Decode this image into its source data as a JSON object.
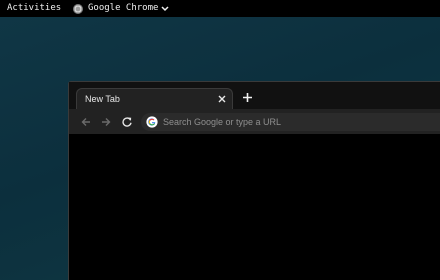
{
  "topbar": {
    "activities_label": "Activities",
    "app_name": "Google Chrome",
    "app_icon": "chrome-icon"
  },
  "browser": {
    "tabs": [
      {
        "label": "New Tab",
        "active": true
      }
    ],
    "toolbar": {
      "back_icon": "arrow-left-icon",
      "forward_icon": "arrow-right-icon",
      "reload_icon": "reload-icon"
    },
    "omnibox": {
      "value": "",
      "placeholder": "Search Google or type a URL",
      "icon": "google-g-icon"
    }
  },
  "colors": {
    "desktop_bg": "#0e3340",
    "topbar_bg": "#000000",
    "tabstrip_bg": "#111111",
    "toolbar_bg": "#222222",
    "content_bg": "#000000"
  }
}
